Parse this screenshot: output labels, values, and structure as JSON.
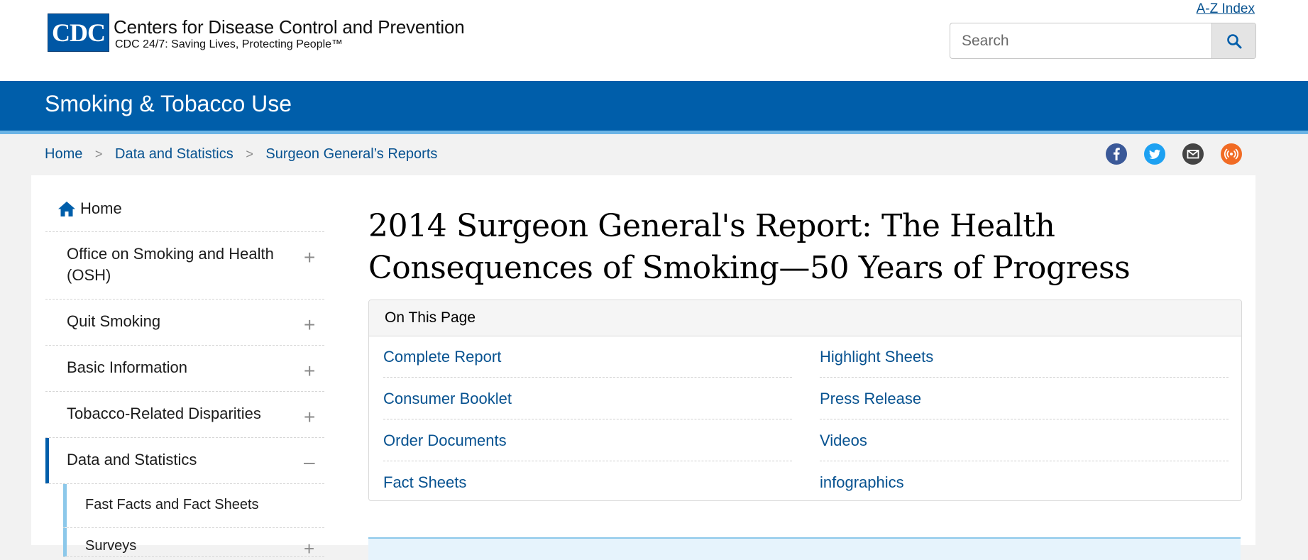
{
  "header": {
    "logo_text": "CDC",
    "org_name": "Centers for Disease Control and Prevention",
    "tagline": "CDC 24/7: Saving Lives, Protecting People™",
    "az_index": "A-Z Index",
    "search_placeholder": "Search"
  },
  "banner": {
    "title": "Smoking & Tobacco Use"
  },
  "breadcrumb": [
    "Home",
    "Data and Statistics",
    "Surgeon General’s Reports"
  ],
  "breadcrumb_separator": ">",
  "social": [
    "facebook-icon",
    "twitter-icon",
    "email-icon",
    "syndicate-icon"
  ],
  "sidebar": {
    "home": "Home",
    "items": [
      {
        "label_line1": "Office on Smoking and Health",
        "label_line2": "(OSH)",
        "toggle": "+"
      },
      {
        "label": "Quit Smoking",
        "toggle": "+"
      },
      {
        "label": "Basic Information",
        "toggle": "+"
      },
      {
        "label": "Tobacco-Related Disparities",
        "toggle": "+"
      },
      {
        "label": "Data and Statistics",
        "toggle": "–"
      }
    ],
    "subitems": [
      {
        "label": "Fast Facts and Fact Sheets"
      },
      {
        "label": "Surveys",
        "toggle": "+"
      }
    ]
  },
  "main": {
    "title_line1": "2014 Surgeon General's Report: The Health",
    "title_line2": "Consequences of Smoking—50 Years of Progress",
    "on_this_page": {
      "heading": "On This Page",
      "links": [
        "Complete Report",
        "Highlight Sheets",
        "Consumer Booklet",
        "Press Release",
        "Order Documents",
        "Videos",
        "Fact Sheets",
        "infographics"
      ]
    }
  },
  "colors": {
    "brand_blue": "#005eaa",
    "link_blue": "#075290",
    "accent_light_blue": "#8cc8ea"
  }
}
